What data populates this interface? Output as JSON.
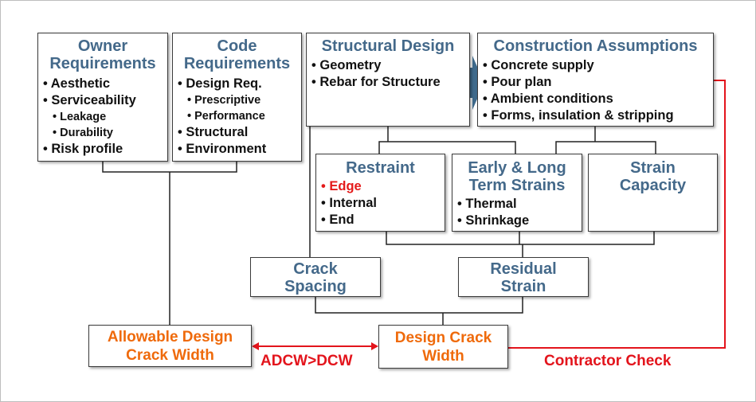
{
  "owner": {
    "title": "Owner Requirements",
    "items": [
      "Aesthetic",
      "Serviceability",
      "Leakage",
      "Durability",
      "Risk profile"
    ]
  },
  "code": {
    "title": "Code Requirements",
    "items": [
      "Design Req.",
      "Prescriptive",
      "Performance",
      "Structural",
      "Environment"
    ]
  },
  "structural": {
    "title": "Structural Design",
    "items": [
      "Geometry",
      "Rebar for Structure"
    ]
  },
  "construction": {
    "title": "Construction Assumptions",
    "items": [
      "Concrete supply",
      "Pour plan",
      "Ambient conditions",
      "Forms, insulation & stripping"
    ]
  },
  "restraint": {
    "title": "Restraint",
    "items": [
      "Edge",
      "Internal",
      "End"
    ]
  },
  "strains": {
    "title": "Early & Long Term Strains",
    "items": [
      "Thermal",
      "Shrinkage"
    ]
  },
  "capacity": {
    "title": "Strain Capacity"
  },
  "spacing": {
    "title": "Crack Spacing"
  },
  "residual": {
    "title": "Residual Strain"
  },
  "allowable": {
    "title": "Allowable Design Crack Width"
  },
  "design": {
    "title": "Design Crack Width"
  },
  "labels": {
    "compare": "ADCW>DCW",
    "contractor": "Contractor Check"
  },
  "colors": {
    "title": "#44698a",
    "output": "#ef6a0b",
    "check": "#e3141c",
    "arrow": "#3f6a8c"
  }
}
